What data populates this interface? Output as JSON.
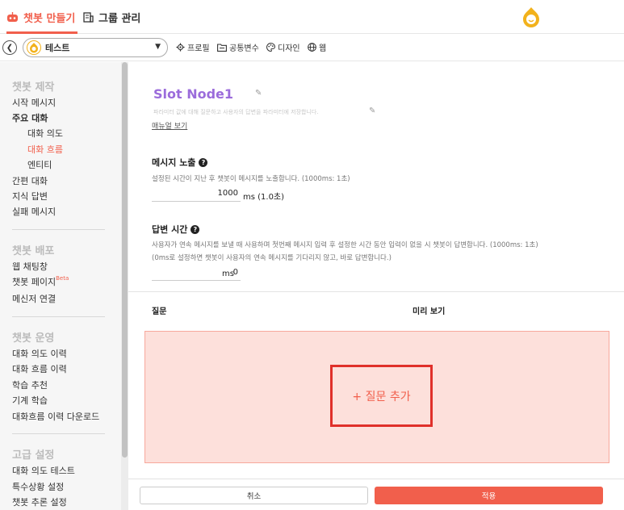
{
  "header": {
    "tabs": [
      {
        "label": "챗봇 만들기",
        "icon": "robot-icon",
        "active": true
      },
      {
        "label": "그룹 관리",
        "icon": "building-icon",
        "active": false
      }
    ],
    "logo": "bot-logo-icon",
    "accent": "#f15f4c"
  },
  "toolbar": {
    "back_icon": "chevron-left-icon",
    "bot_select": {
      "value": "테스트"
    },
    "items": [
      {
        "label": "프로필",
        "icon": "gear-icon"
      },
      {
        "label": "공통변수",
        "icon": "folder-icon"
      },
      {
        "label": "디자인",
        "icon": "palette-icon"
      },
      {
        "label": "웹",
        "icon": "globe-icon"
      }
    ]
  },
  "sidebar": {
    "sections": [
      {
        "title": "챗봇 제작",
        "items": [
          {
            "label": "시작 메시지"
          },
          {
            "label": "주요 대화",
            "bold": true
          },
          {
            "label": "대화 의도",
            "sub": true
          },
          {
            "label": "대화 흐름",
            "sub": true,
            "active": true
          },
          {
            "label": "엔티티",
            "sub": true
          },
          {
            "label": "간편 대화"
          },
          {
            "label": "지식 답변"
          },
          {
            "label": "실패 메시지"
          }
        ]
      },
      {
        "title": "챗봇 배포",
        "items": [
          {
            "label": "웹 채팅창"
          },
          {
            "label": "챗봇 페이지",
            "badge": "Beta"
          },
          {
            "label": "메신저 연결"
          }
        ]
      },
      {
        "title": "챗봇 운영",
        "items": [
          {
            "label": "대화 의도 이력"
          },
          {
            "label": "대화 흐름 이력"
          },
          {
            "label": "학습 추천"
          },
          {
            "label": "기계 학습"
          },
          {
            "label": "대화흐름 이력 다운로드"
          }
        ]
      },
      {
        "title": "고급 설정",
        "items": [
          {
            "label": "대화 의도 테스트"
          },
          {
            "label": "특수상황 설정"
          },
          {
            "label": "챗봇 추론 설정"
          }
        ]
      }
    ]
  },
  "main": {
    "title": "Slot Node1",
    "description": "파라미터 값에 대해 질문하고 사용자의 답변을 파라미터에 저장합니다.",
    "manual_link": "매뉴얼 보기",
    "message_exposure": {
      "heading": "메시지 노출",
      "desc": "설정된 시간이 지난 후 챗봇이 메시지를 노출합니다. (1000ms: 1초)",
      "value": "1000",
      "unit": "ms (1.0초)"
    },
    "answer_time": {
      "heading": "답변 시간",
      "desc1": "사용자가 연속 메시지를 보낼 때 사용하며 첫번째 메시지 입력 후 설정한 시간 동안 입력이 없을 시 챗봇이 답변합니다. (1000ms: 1초)",
      "desc2": "(0ms로 설정하면 챗봇이 사용자의 연속 메시지를 기다리지 않고, 바로 답변합니다.)",
      "value": "0",
      "unit": "ms"
    },
    "columns": {
      "question": "질문",
      "preview": "미리 보기"
    },
    "add_question": "+ 질문 추가",
    "cancel": "취소",
    "apply": "적용"
  }
}
